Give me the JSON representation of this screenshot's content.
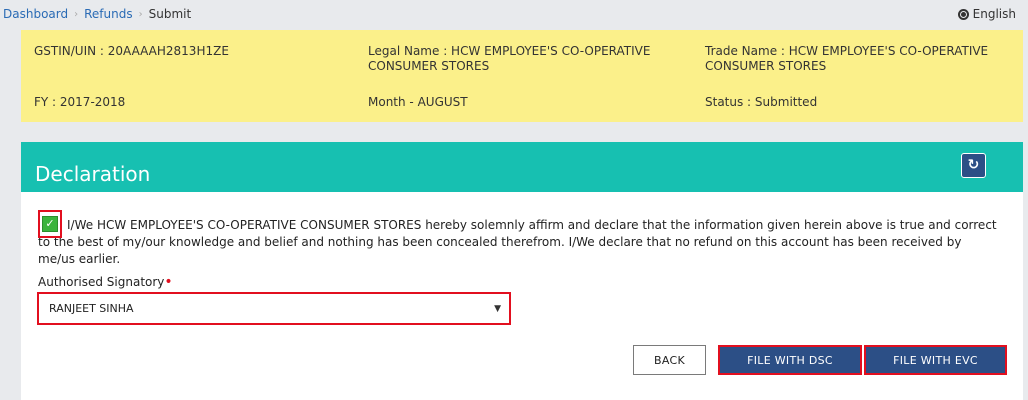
{
  "breadcrumb": {
    "items": [
      "Dashboard",
      "Refunds"
    ],
    "current": "Submit"
  },
  "language": "English",
  "info": {
    "gstin": "GSTIN/UIN : 20AAAAH2813H1ZE",
    "legal_name": "Legal Name : HCW EMPLOYEE'S CO-OPERATIVE CONSUMER STORES",
    "trade_name": "Trade Name : HCW EMPLOYEE'S CO-OPERATIVE CONSUMER STORES",
    "fy": "FY : 2017-2018",
    "month": "Month - AUGUST",
    "status": "Status : Submitted"
  },
  "declaration": {
    "title": "Declaration",
    "checked": true,
    "text": "I/We HCW EMPLOYEE'S CO-OPERATIVE CONSUMER STORES hereby solemnly affirm and declare that the information given herein above is true and correct to the best of my/our knowledge and belief and nothing has been concealed therefrom. I/We declare that no refund on this account has been received by me/us earlier.",
    "signatory_label": "Authorised Signatory",
    "signatory_value": "RANJEET SINHA"
  },
  "buttons": {
    "back": "BACK",
    "file_dsc": "FILE WITH DSC",
    "file_evc": "FILE WITH EVC"
  },
  "colors": {
    "info_bg": "#fbf08a",
    "header_bg": "#17c0b1",
    "primary_button": "#2c4f86",
    "highlight": "#e20f1f"
  }
}
